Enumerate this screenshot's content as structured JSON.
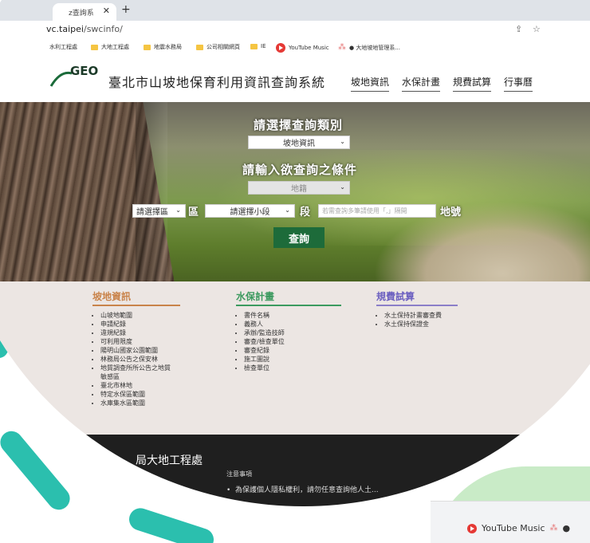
{
  "browser": {
    "tab_title": "z查詢系",
    "tab_close": "✕",
    "new_tab": "+",
    "url_host": "vc.taipei",
    "url_path": "/swcinfo/",
    "bookmarks": [
      "水利工程處",
      "大地工程處",
      "地震水務局",
      "公司相關網頁",
      "IE",
      "YouTube Music",
      "● 大地坡地管理系..."
    ]
  },
  "header": {
    "logo_text": "GEO",
    "site_title": "臺北市山坡地保育利用資訊查詢系統",
    "nav": [
      "坡地資訊",
      "水保計畫",
      "規費試算",
      "行事曆"
    ]
  },
  "hero": {
    "heading_category": "請選擇查詢類別",
    "category_value": "坡地資訊",
    "heading_condition": "請輸入欲查詢之條件",
    "condition_value": "地籍",
    "district_value": "請選擇區",
    "district_suffix": "區",
    "section_value": "請選擇小段",
    "section_suffix": "段",
    "lot_placeholder": "若需查詢多筆請使用「,」隔開",
    "lot_suffix": "地號",
    "query_button": "查詢"
  },
  "links": {
    "columns": [
      {
        "title": "坡地資訊",
        "color": "#c9834a",
        "items": [
          "山坡地範圍",
          "申請紀錄",
          "違規紀錄",
          "可利用限度",
          "陽明山國家公園範圍",
          "林務局公告之保安林",
          "地質調查所所公告之地質",
          "敏感區",
          "臺北市林地",
          "特定水保區範圍",
          "水庫集水區範圍"
        ]
      },
      {
        "title": "水保計畫",
        "color": "#3c9a5f",
        "items": [
          "書件名稱",
          "義務人",
          "承辦/監造技師",
          "審查/檢查單位",
          "審查紀錄",
          "施工圖說",
          "檢查單位"
        ]
      },
      {
        "title": "規費試算",
        "color": "#8b7fc8",
        "items": [
          "水土保持計畫審查費",
          "水土保持保證金"
        ]
      }
    ]
  },
  "footer": {
    "title": "局大地工程處",
    "notice_title": "注意事項",
    "notice": "為保護個人隱私權利，請勿任意查詢他人土..."
  },
  "bottom_bookmark": {
    "label": "YouTube Music"
  }
}
